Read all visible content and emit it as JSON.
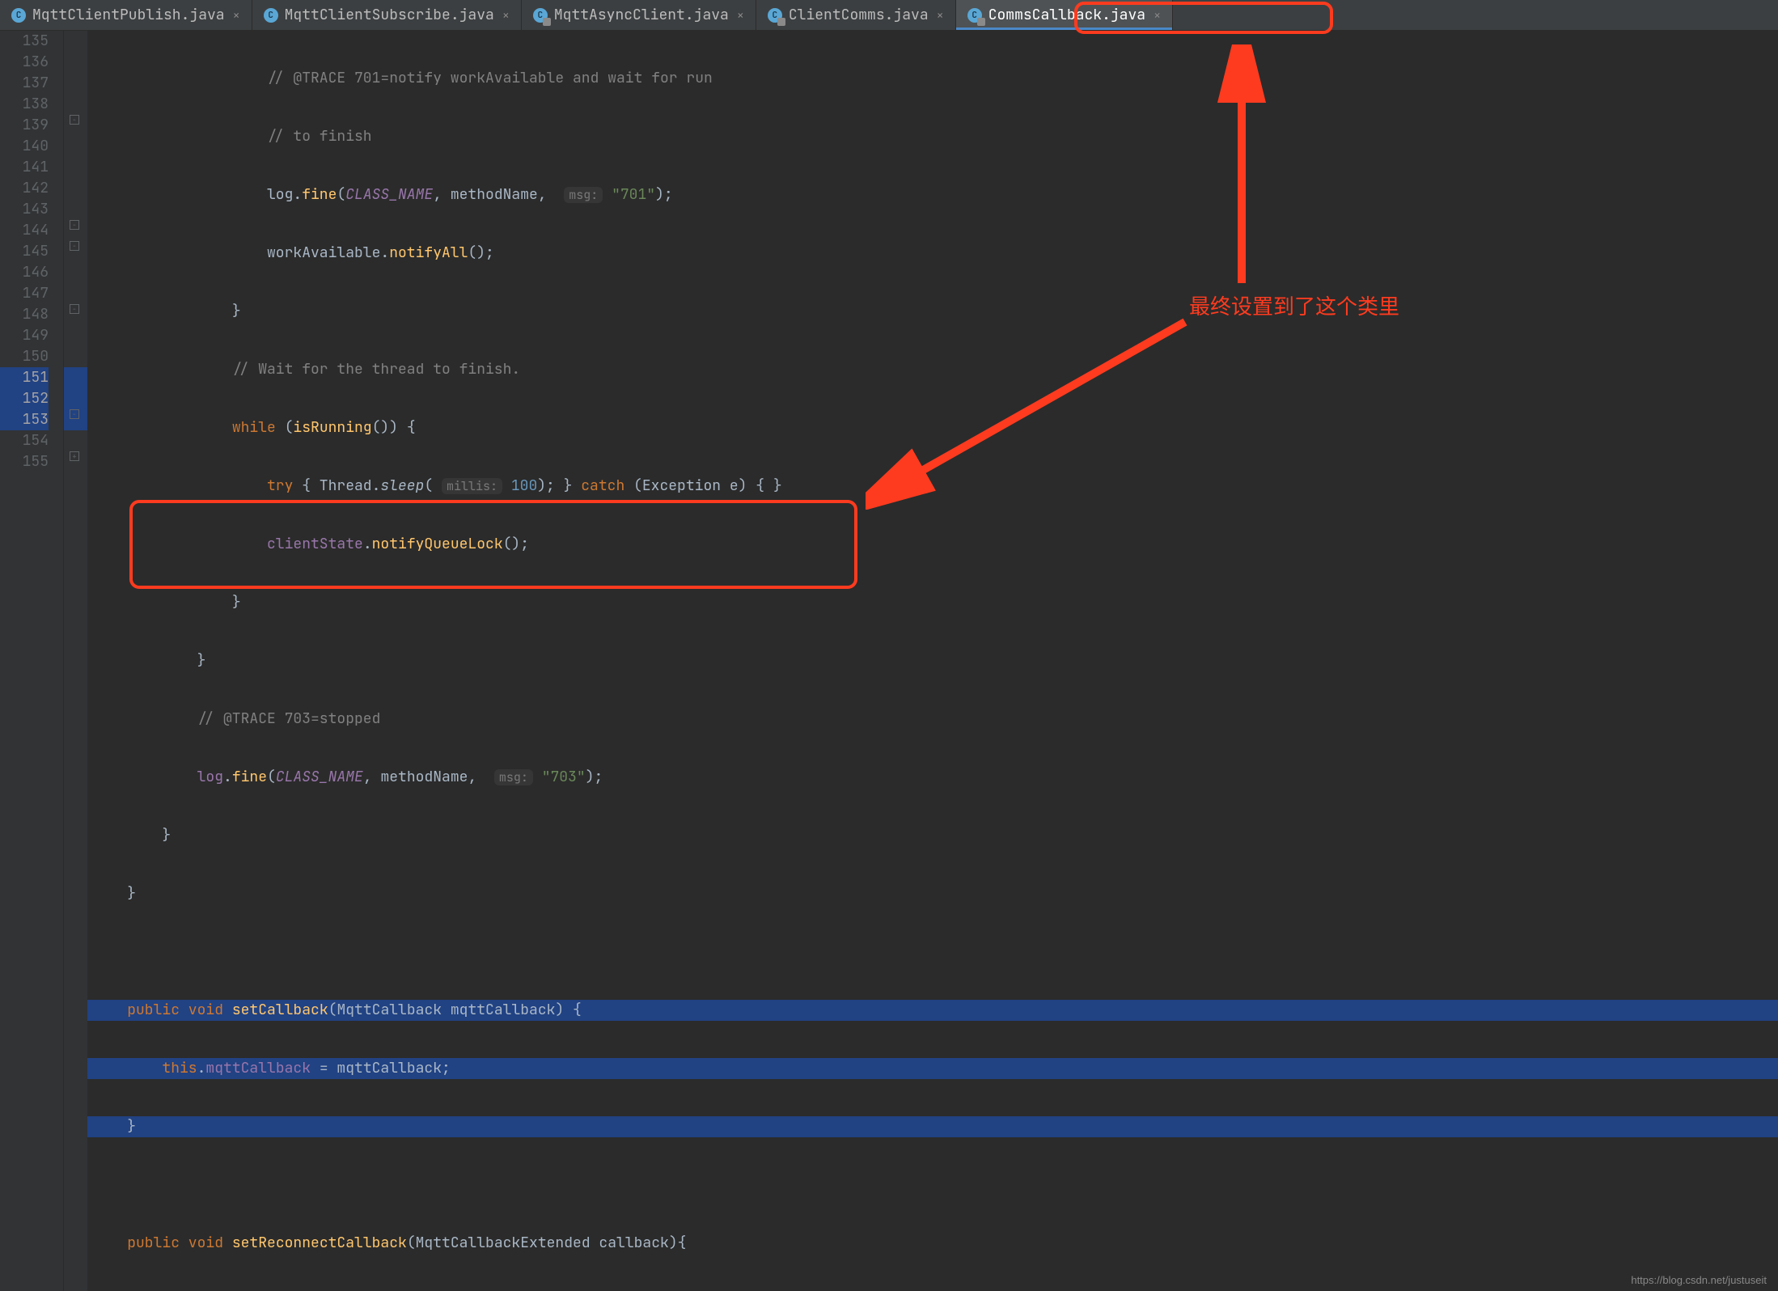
{
  "tabs": [
    {
      "label": "MqttClientPublish.java",
      "active": false
    },
    {
      "label": "MqttClientSubscribe.java",
      "active": false
    },
    {
      "label": "MqttAsyncClient.java",
      "active": false
    },
    {
      "label": "ClientComms.java",
      "active": false
    },
    {
      "label": "CommsCallback.java",
      "active": true
    }
  ],
  "line_numbers": [
    "135",
    "136",
    "137",
    "138",
    "139",
    "140",
    "141",
    "142",
    "143",
    "144",
    "145",
    "146",
    "147",
    "148",
    "149",
    "150",
    "151",
    "152",
    "153",
    "154",
    "155"
  ],
  "annotation": {
    "text": "最终设置到了这个类里"
  },
  "watermark": "https://blog.csdn.net/justuseit",
  "code": {
    "l135": "// @TRACE 701=notify workAvailable and wait for run",
    "l136": "// to finish",
    "l137_a": "log.",
    "l137_b": "fine",
    "l137_c": "CLASS_NAME",
    "l137_d": ", methodName, ",
    "l137_hint": "msg:",
    "l137_e": "\"701\"",
    "l137_f": ");",
    "l138_a": "workAvailable.",
    "l138_b": "notifyAll",
    "l138_c": "();",
    "l139": "}",
    "l140": "// Wait for the thread to finish.",
    "l141_a": "while",
    "l141_b": " (",
    "l141_c": "isRunning",
    "l141_d": "()) {",
    "l142_a": "try",
    "l142_b": " { Thread.",
    "l142_c": "sleep",
    "l142_d": "( ",
    "l142_hint": "millis:",
    "l142_e": "100",
    "l142_f": "); } ",
    "l142_g": "catch",
    "l142_h": " (Exception e) { }",
    "l143_a": "clientState",
    "l143_b": ".",
    "l143_c": "notifyQueueLock",
    "l143_d": "();",
    "l144": "}",
    "l145": "}",
    "l146": "// @TRACE 703=stopped",
    "l147_a": "log",
    "l147_b": ".",
    "l147_c": "fine",
    "l147_d": "CLASS_NAME",
    "l147_e": ", methodName, ",
    "l147_hint": "msg:",
    "l147_f": "\"703\"",
    "l147_g": ");",
    "l148": "}",
    "l149": "}",
    "l151_a": "public void",
    "l151_b": "setCallback",
    "l151_c": "(MqttCallback mqttCallback) {",
    "l152_a": "this",
    "l152_b": ".",
    "l152_c": "mqttCallback",
    "l152_d": " = mqttCallback;",
    "l153": "}",
    "l155_a": "public void",
    "l155_b": "setReconnectCallback",
    "l155_c": "(MqttCallbackExtended callback){"
  }
}
